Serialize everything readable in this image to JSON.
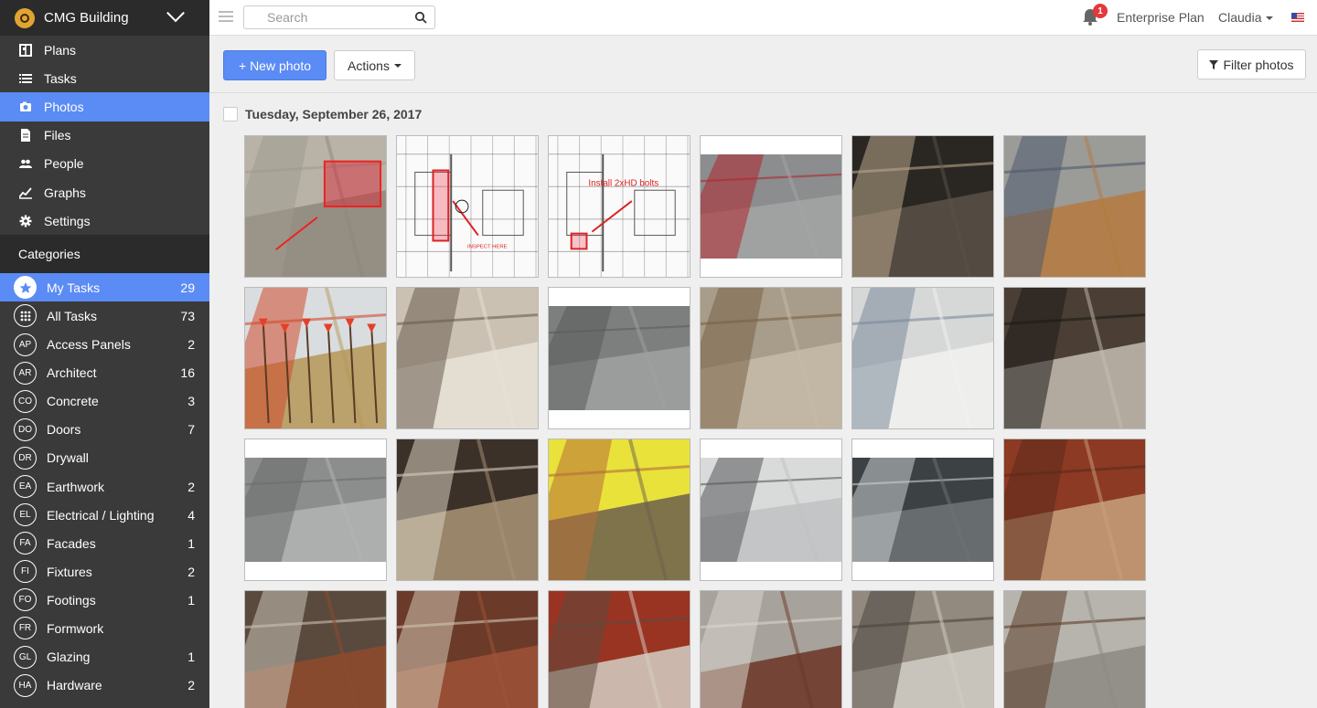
{
  "project": {
    "name": "CMG Building",
    "logo_icon": "hardhat-icon"
  },
  "nav": [
    {
      "label": "Plans",
      "icon": "plans-icon"
    },
    {
      "label": "Tasks",
      "icon": "list-icon"
    },
    {
      "label": "Photos",
      "icon": "camera-icon",
      "active": true
    },
    {
      "label": "Files",
      "icon": "file-icon"
    },
    {
      "label": "People",
      "icon": "people-icon"
    },
    {
      "label": "Graphs",
      "icon": "chart-icon"
    },
    {
      "label": "Settings",
      "icon": "gear-icon"
    }
  ],
  "categories_header": "Categories",
  "categories": [
    {
      "badge": "★",
      "label": "My Tasks",
      "count": "29",
      "active": true
    },
    {
      "badge": "⠿",
      "label": "All Tasks",
      "count": "73"
    },
    {
      "badge": "AP",
      "label": "Access Panels",
      "count": "2"
    },
    {
      "badge": "AR",
      "label": "Architect",
      "count": "16"
    },
    {
      "badge": "CO",
      "label": "Concrete",
      "count": "3"
    },
    {
      "badge": "DO",
      "label": "Doors",
      "count": "7"
    },
    {
      "badge": "DR",
      "label": "Drywall",
      "count": ""
    },
    {
      "badge": "EA",
      "label": "Earthwork",
      "count": "2"
    },
    {
      "badge": "EL",
      "label": "Electrical / Lighting",
      "count": "4"
    },
    {
      "badge": "FA",
      "label": "Facades",
      "count": "1"
    },
    {
      "badge": "FI",
      "label": "Fixtures",
      "count": "2"
    },
    {
      "badge": "FO",
      "label": "Footings",
      "count": "1"
    },
    {
      "badge": "FR",
      "label": "Formwork",
      "count": ""
    },
    {
      "badge": "GL",
      "label": "Glazing",
      "count": "1"
    },
    {
      "badge": "HA",
      "label": "Hardware",
      "count": "2"
    }
  ],
  "topbar": {
    "search_placeholder": "Search",
    "notification_count": "1",
    "plan": "Enterprise Plan",
    "user": "Claudia"
  },
  "toolbar": {
    "new_photo": "+ New photo",
    "actions": "Actions",
    "filter": "Filter photos"
  },
  "date_group": "Tuesday, September 26, 2017",
  "plan_annotations": {
    "inspect": "INSPECT HERE",
    "install": "Install 2xHD bolts"
  },
  "photos": [
    {
      "kind": "wood-markup"
    },
    {
      "kind": "plan-inspect"
    },
    {
      "kind": "plan-install"
    },
    {
      "kind": "slab-red-wall",
      "boxed": true
    },
    {
      "kind": "ceiling-ducts"
    },
    {
      "kind": "orange-hatch"
    },
    {
      "kind": "rebar-stakes"
    },
    {
      "kind": "sink-bathroom"
    },
    {
      "kind": "concrete-slab",
      "boxed": true
    },
    {
      "kind": "debris-floor"
    },
    {
      "kind": "white-pipes"
    },
    {
      "kind": "room-ladder"
    },
    {
      "kind": "slab-crack",
      "boxed": true
    },
    {
      "kind": "steel-studs"
    },
    {
      "kind": "yellow-formwork"
    },
    {
      "kind": "grid-ceiling",
      "boxed": true
    },
    {
      "kind": "dark-ceiling",
      "boxed": true
    },
    {
      "kind": "red-beams"
    },
    {
      "kind": "red-beams-2"
    },
    {
      "kind": "red-beams-3"
    },
    {
      "kind": "red-beams-4"
    },
    {
      "kind": "ducts-angle"
    },
    {
      "kind": "corridor"
    },
    {
      "kind": "stud-wall"
    }
  ]
}
